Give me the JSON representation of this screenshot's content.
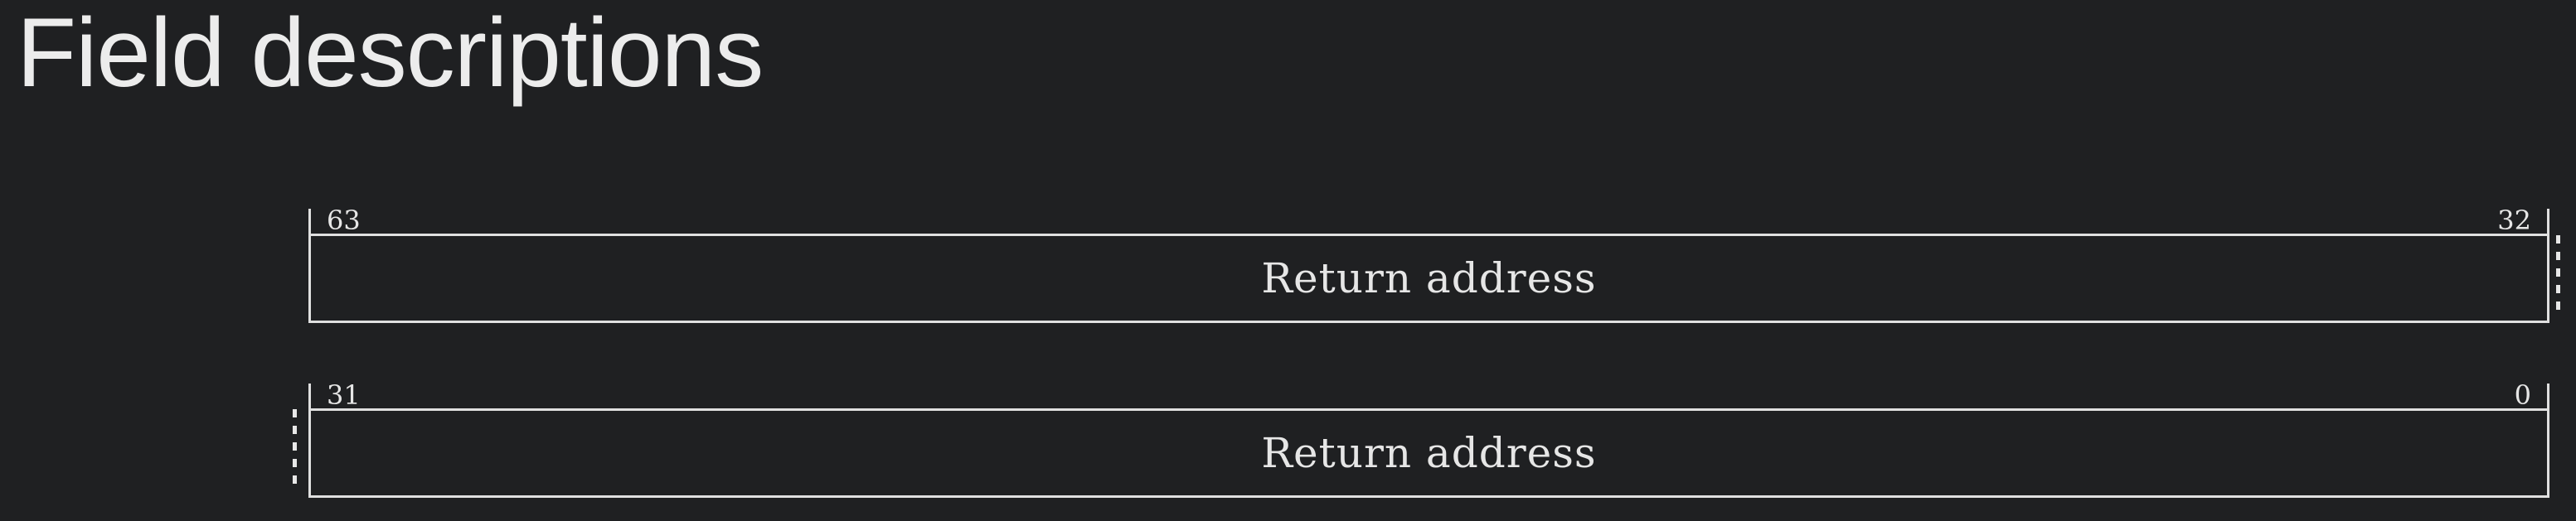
{
  "page": {
    "title": "Field descriptions"
  },
  "register": {
    "rows": [
      {
        "msb": "63",
        "lsb": "32",
        "field": "Return address"
      },
      {
        "msb": "31",
        "lsb": "0",
        "field": "Return address"
      }
    ]
  },
  "colors": {
    "background": "#1f2022",
    "line": "#e0e0e0",
    "text": "#e8e8e8"
  }
}
